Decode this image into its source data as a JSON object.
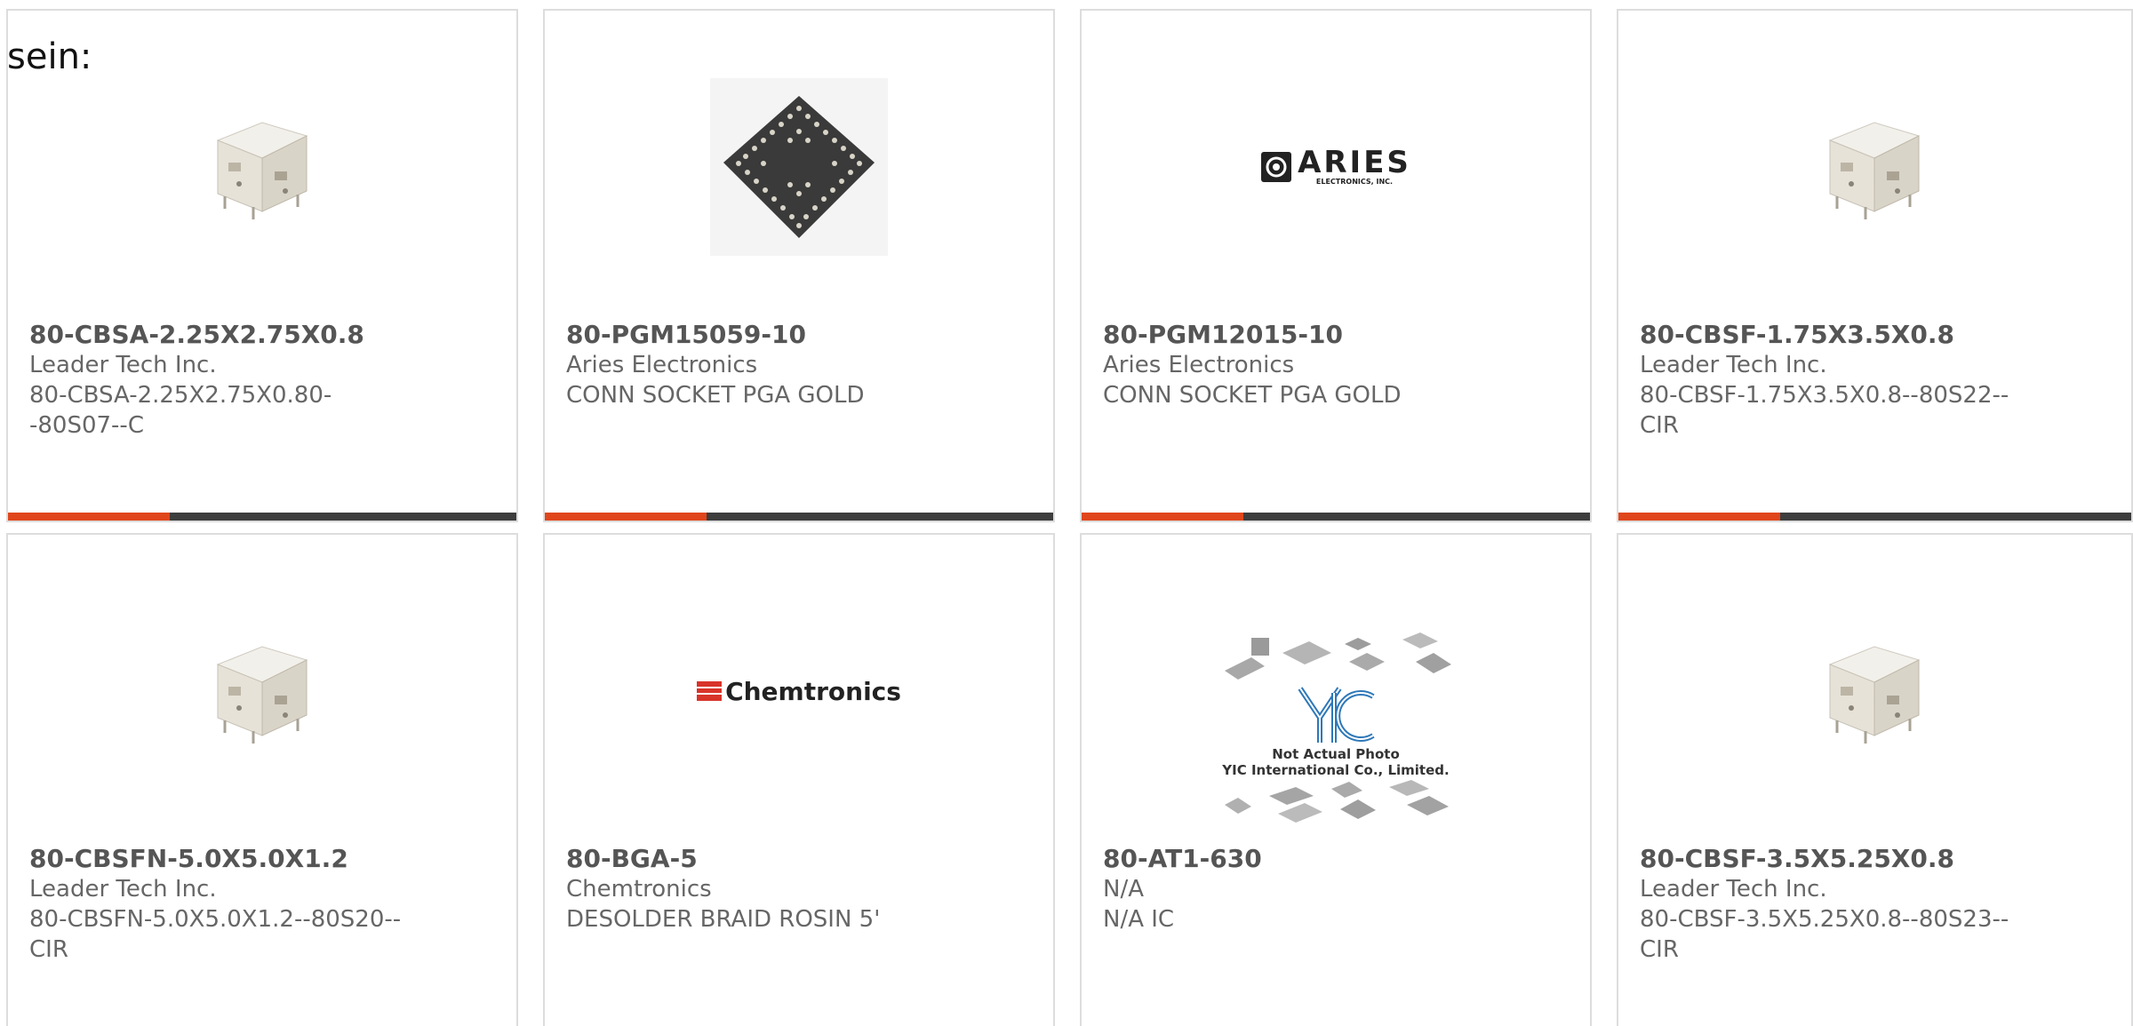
{
  "heading": "sein:",
  "products": [
    {
      "part_number": "80-CBSA-2.25X2.75X0.8",
      "manufacturer": "Leader Tech Inc.",
      "description": "80-CBSA-2.25X2.75X0.80--80S07--C",
      "image": "shield-can-photo"
    },
    {
      "part_number": "80-PGM15059-10",
      "manufacturer": "Aries Electronics",
      "description": "CONN SOCKET PGA GOLD",
      "image": "pga-socket-photo"
    },
    {
      "part_number": "80-PGM12015-10",
      "manufacturer": "Aries Electronics",
      "description": "CONN SOCKET PGA GOLD",
      "image": "aries-logo",
      "logo_text": "ARIES",
      "logo_sub": "ELECTRONICS, INC."
    },
    {
      "part_number": "80-CBSF-1.75X3.5X0.8",
      "manufacturer": "Leader Tech Inc.",
      "description": "80-CBSF-1.75X3.5X0.8--80S22--CIR",
      "image": "shield-can-photo"
    },
    {
      "part_number": "80-CBSFN-5.0X5.0X1.2",
      "manufacturer": "Leader Tech Inc.",
      "description": "80-CBSFN-5.0X5.0X1.2--80S20--CIR",
      "image": "shield-can-photo"
    },
    {
      "part_number": "80-BGA-5",
      "manufacturer": "Chemtronics",
      "description": "DESOLDER BRAID ROSIN 5'",
      "image": "chemtronics-logo",
      "logo_text": "Chemtronics"
    },
    {
      "part_number": "80-AT1-630",
      "manufacturer": "N/A",
      "description": "N/A IC",
      "image": "not-actual-photo",
      "photo_note": "Not Actual Photo",
      "photo_company": "YIC International Co., Limited."
    },
    {
      "part_number": "80-CBSF-3.5X5.25X0.8",
      "manufacturer": "Leader Tech Inc.",
      "description": "80-CBSF-3.5X5.25X0.8--80S23--CIR",
      "image": "shield-can-photo"
    }
  ],
  "colors": {
    "accent": "#e0461c",
    "bar": "#3d3d3d",
    "border": "#dddddd"
  }
}
